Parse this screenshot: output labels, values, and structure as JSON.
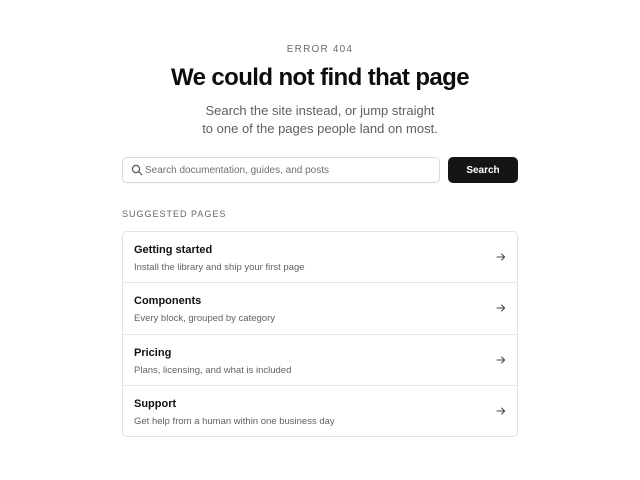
{
  "header": {
    "eyebrow": "ERROR 404",
    "title": "We could not find that page",
    "subtitle_line1": "Search the site instead, or jump straight",
    "subtitle_line2": "to one of the pages people land on most."
  },
  "search": {
    "placeholder": "Search documentation, guides, and posts",
    "value": "",
    "button_label": "Search",
    "icon": "search-icon"
  },
  "suggested": {
    "label": "SUGGESTED PAGES",
    "items": [
      {
        "title": "Getting started",
        "description": "Install the library and ship your first page",
        "icon": "arrow-right-icon"
      },
      {
        "title": "Components",
        "description": "Every block, grouped by category",
        "icon": "arrow-right-icon"
      },
      {
        "title": "Pricing",
        "description": "Plans, licensing, and what is included",
        "icon": "arrow-right-icon"
      },
      {
        "title": "Support",
        "description": "Get help from a human within one business day",
        "icon": "arrow-right-icon"
      }
    ]
  },
  "colors": {
    "background": "#ffffff",
    "text_primary": "#111111",
    "text_muted": "#626262",
    "button_bg": "#151515",
    "border": "#e1e1e1"
  }
}
